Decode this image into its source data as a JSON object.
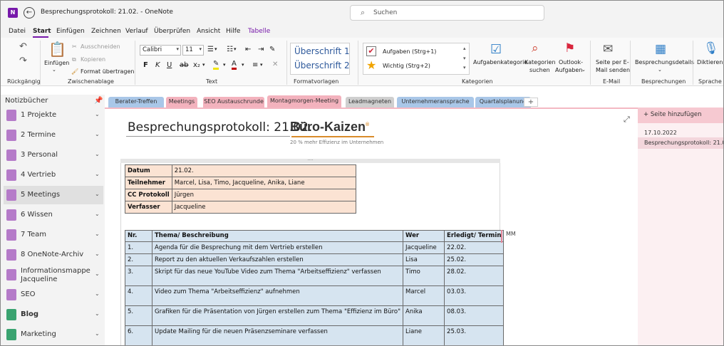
{
  "app": {
    "logo": "N",
    "window_title": "Besprechungsprotokoll: 21.02.  -  OneNote"
  },
  "search": {
    "placeholder": "Suchen"
  },
  "menu": [
    "Datei",
    "Start",
    "Einfügen",
    "Zeichnen",
    "Verlauf",
    "Überprüfen",
    "Ansicht",
    "Hilfe",
    "Tabelle"
  ],
  "ribbon": {
    "undo_group": "Rückgängig",
    "clipboard": {
      "paste": "Einfügen",
      "cut": "Ausschneiden",
      "copy": "Kopieren",
      "format_painter": "Format übertragen",
      "group": "Zwischenablage"
    },
    "text": {
      "font": "Calibri",
      "size": "11",
      "group": "Text"
    },
    "styles": {
      "h1": "Überschrift 1",
      "h2": "Überschrift 2",
      "group": "Formatvorlagen"
    },
    "tags": {
      "task": "Aufgaben (Strg+1)",
      "important": "Wichtig (Strg+2)",
      "task_cat": "Aufgabenkategorie",
      "search_cat1": "Kategorien",
      "search_cat2": "suchen",
      "outlook1": "Outlook-",
      "outlook2": "Aufgaben",
      "group": "Kategorien"
    },
    "email": {
      "l1": "Seite per E-",
      "l2": "Mail senden",
      "group": "E-Mail"
    },
    "meetings": {
      "label": "Besprechungsdetails",
      "group": "Besprechungen"
    },
    "voice": {
      "label": "Diktieren",
      "group": "Sprache"
    }
  },
  "notebooks": {
    "header": "Notizbücher",
    "items": [
      {
        "label": "1 Projekte",
        "color": "#b57bc9"
      },
      {
        "label": "2 Termine",
        "color": "#b57bc9"
      },
      {
        "label": "3 Personal",
        "color": "#b57bc9"
      },
      {
        "label": "4 Vertrieb",
        "color": "#b57bc9"
      },
      {
        "label": "5 Meetings",
        "color": "#b57bc9"
      },
      {
        "label": "6 Wissen",
        "color": "#b57bc9"
      },
      {
        "label": "7 Team",
        "color": "#b57bc9"
      },
      {
        "label": "8 OneNote-Archiv",
        "color": "#b57bc9"
      },
      {
        "label": "Informationsmappe",
        "label2": "Jacqueline",
        "color": "#b57bc9"
      },
      {
        "label": "SEO",
        "color": "#b57bc9"
      },
      {
        "label": "Blog",
        "color": "#3aa370"
      },
      {
        "label": "Marketing",
        "color": "#3aa370"
      }
    ]
  },
  "sections": [
    {
      "label": "Berater-Treffen",
      "color": "#a9c7e8"
    },
    {
      "label": "Meetings",
      "color": "#f3b2bd"
    },
    {
      "label": "SEO Austauschrunde",
      "color": "#f3b2bd"
    },
    {
      "label": "Montagmorgen-Meeting",
      "color": "#f3b2bd"
    },
    {
      "label": "Leadmagneten",
      "color": "#cfcfcf"
    },
    {
      "label": "Unternehmeransprache",
      "color": "#a9c7e8"
    },
    {
      "label": "Quartalsplanung",
      "color": "#a9c7e8"
    }
  ],
  "page": {
    "title": "Besprechungsprotokoll: 21.02.",
    "logo": "Büro-Kaizen",
    "logo_mark": "®",
    "slogan": "20 % mehr Effizienz im Unternehmen",
    "info": [
      {
        "key": "Datum",
        "value": "21.02."
      },
      {
        "key": "Teilnehmer",
        "value": "Marcel, Lisa, Timo, Jacqueline, Anika, Liane"
      },
      {
        "key": "CC Protokoll",
        "value": "Jürgen"
      },
      {
        "key": "Verfasser",
        "value": "Jacqueline"
      }
    ],
    "task_headers": [
      "Nr.",
      "Thema/ Beschreibung",
      "Wer",
      "Erledigt/ Termin"
    ],
    "tasks": [
      {
        "nr": "1.",
        "topic": "Agenda für die Besprechung mit dem Vertrieb erstellen",
        "who": "Jacqueline",
        "date": "22.02."
      },
      {
        "nr": "2.",
        "topic": "Report zu den aktuellen Verkaufszahlen erstellen",
        "who": "Lisa",
        "date": "25.02."
      },
      {
        "nr": "3.",
        "topic": "Skript für das neue YouTube Video zum Thema \"Arbeitseffizienz\" verfassen",
        "who": "Timo",
        "date": "28.02."
      },
      {
        "nr": "4.",
        "topic": "Video zum Thema \"Arbeitseffizienz\" aufnehmen",
        "who": "Marcel",
        "date": "03.03."
      },
      {
        "nr": "5.",
        "topic": "Grafiken für die Präsentation von Jürgen erstellen zum Thema \"Effizienz im Büro\"",
        "who": "Anika",
        "date": "08.03."
      },
      {
        "nr": "6.",
        "topic": "Update Mailing für die neuen Präsenzseminare verfassen",
        "who": "Liane",
        "date": "25.03."
      }
    ],
    "author_tag": "MM"
  },
  "pages_panel": {
    "add_page": "Seite hinzufügen",
    "date": "17.10.2022",
    "page_entry": "Besprechungsprotokoll: 21.02."
  }
}
